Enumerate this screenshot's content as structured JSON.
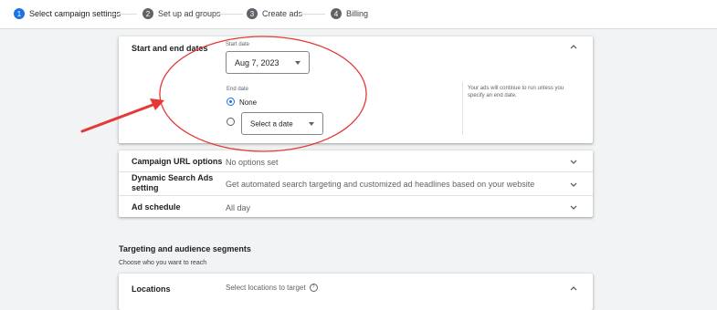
{
  "steps": [
    {
      "num": "1",
      "label": "Select campaign settings",
      "active": true
    },
    {
      "num": "2",
      "label": "Set up ad groups",
      "active": false
    },
    {
      "num": "3",
      "label": "Create ads",
      "active": false
    },
    {
      "num": "4",
      "label": "Billing",
      "active": false
    }
  ],
  "dates_card": {
    "title": "Start and end dates",
    "start_label": "Start date",
    "start_value": "Aug 7, 2023",
    "end_label": "End date",
    "end_options": [
      {
        "label": "None",
        "selected": true
      },
      {
        "label": "Select a date",
        "selected": false
      }
    ],
    "help_text": "Your ads will continue to run unless you specify an end date."
  },
  "options_card": {
    "rows": [
      {
        "title": "Campaign URL options",
        "value": "No options set"
      },
      {
        "title": "Dynamic Search Ads setting",
        "value": "Get automated search targeting and customized ad headlines based on your website"
      },
      {
        "title": "Ad schedule",
        "value": "All day"
      }
    ]
  },
  "targeting": {
    "title": "Targeting and audience segments",
    "subtitle": "Choose who you want to reach"
  },
  "locations_card": {
    "title": "Locations",
    "value": "Select locations to target",
    "help_icon": "?"
  },
  "annotations": {
    "circle_color": "#e53935",
    "arrow_color": "#e53935"
  },
  "colors": {
    "accent": "#1a73e8",
    "background": "#f1f3f4"
  }
}
